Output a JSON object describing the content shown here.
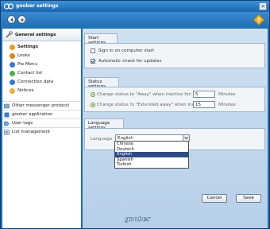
{
  "window": {
    "title": "goober settings"
  },
  "sidebar": {
    "header": "General settings",
    "sub_items": [
      {
        "label": "Settings",
        "icon": "gear-icon",
        "color": "#e0a020",
        "active": true
      },
      {
        "label": "Looks",
        "icon": "palette-icon",
        "color": "#d58a2a",
        "active": false
      },
      {
        "label": "Pie Menu",
        "icon": "pie-menu-icon",
        "color": "#3a7bc8",
        "active": false
      },
      {
        "label": "Contact list",
        "icon": "contact-list-icon",
        "color": "#4caf50",
        "active": false
      },
      {
        "label": "Connection data",
        "icon": "connection-icon",
        "color": "#2f7bd8",
        "active": false
      },
      {
        "label": "Notices",
        "icon": "notices-icon",
        "color": "#e8b33a",
        "active": false
      }
    ],
    "groups": [
      {
        "label": "Other messenger protocol",
        "icon": "protocol-icon"
      },
      {
        "label": "goober application",
        "icon": "application-icon"
      },
      {
        "label": "User tags",
        "icon": "tag-icon"
      },
      {
        "label": "List management",
        "icon": "list-icon"
      }
    ]
  },
  "start_settings": {
    "title": "Start settings",
    "options": [
      {
        "label": "Sign in on computer start",
        "checked": false
      },
      {
        "label": "Automatic check for updates",
        "checked": true
      }
    ]
  },
  "status_settings": {
    "title": "Status settings",
    "rows": [
      {
        "label": "Change status to \"Away\" when inactive for:",
        "value": "5",
        "unit": "Minutes"
      },
      {
        "label": "Change status to \"Extended away\" when inactive for:",
        "value": "15",
        "unit": "Minutes"
      }
    ]
  },
  "language_settings": {
    "title": "Language settings",
    "label": "Language",
    "selected": "English",
    "options": [
      "Chinese",
      "Deutsch",
      "English",
      "Spanish",
      "Turkish"
    ]
  },
  "buttons": {
    "cancel": "Cancel",
    "save": "Save"
  },
  "branding": {
    "logo_text": "goober"
  },
  "colors": {
    "titlebar": "#1b64ad",
    "accent": "#2c4b82",
    "panel": "#cfe0f1"
  }
}
